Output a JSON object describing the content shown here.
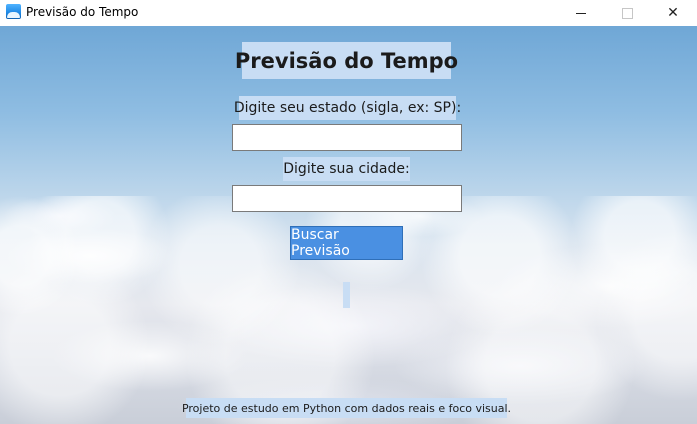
{
  "window": {
    "title": "Previsão do Tempo",
    "icon": "app-weather-icon",
    "controls": {
      "minimize": "minimize-icon",
      "maximize": "maximize-icon",
      "close": "✕"
    }
  },
  "main": {
    "heading": "Previsão do Tempo",
    "state_label": "Digite seu estado (sigla, ex: SP):",
    "state_value": "",
    "city_label": "Digite sua cidade:",
    "city_value": "",
    "search_button": "Buscar Previsão",
    "result_text": "",
    "footer": "Projeto de estudo em Python com dados reais e foco visual."
  },
  "colors": {
    "label_bg": "#c8ddf4",
    "button_bg": "#4a90e2",
    "button_text": "#ffffff"
  }
}
